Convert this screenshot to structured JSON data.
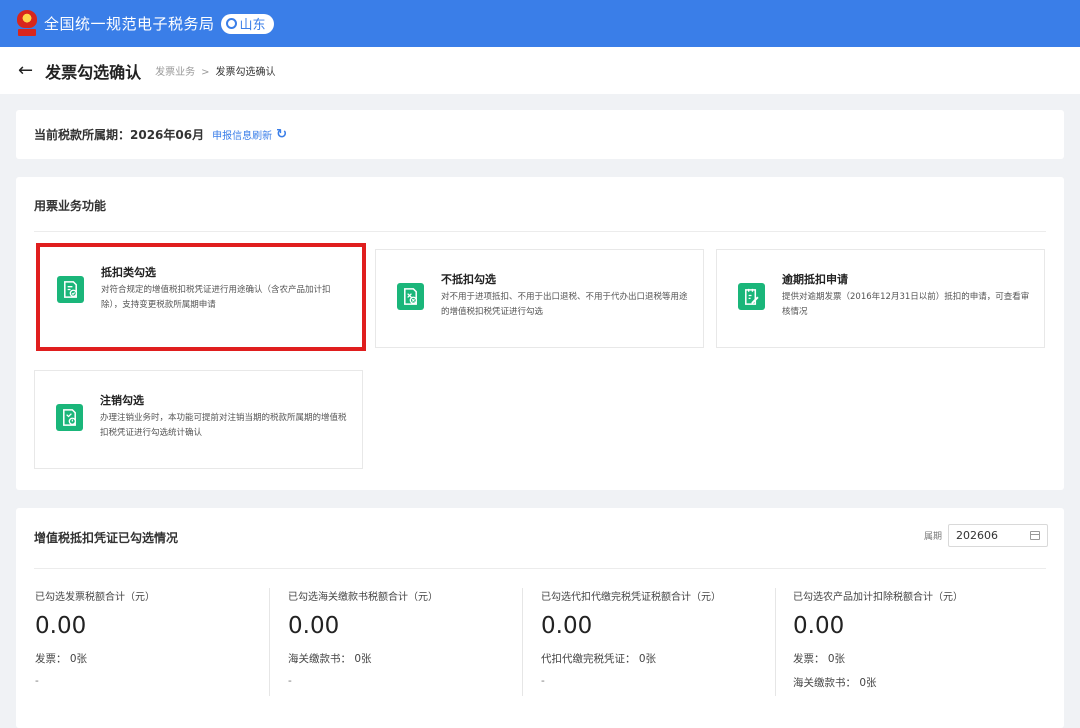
{
  "header": {
    "app_title": "全国统一规范电子税务局",
    "region": "山东"
  },
  "nav": {
    "back_icon": "←",
    "page_title": "发票勾选确认",
    "breadcrumb": [
      "发票业务",
      "发票勾选确认"
    ],
    "breadcrumb_sep": ">"
  },
  "period_bar": {
    "label": "当前税款所属期：2026年06月",
    "refresh_label": "申报信息刷新",
    "refresh_icon": "↻"
  },
  "functions": {
    "title": "用票业务功能",
    "tiles": [
      {
        "title": "抵扣类勾选",
        "desc": "对符合规定的增值税扣税凭证进行用途确认（含农产品加计扣除），支持变更税款所属期申请",
        "icon": "check-doc-icon",
        "selected": true
      },
      {
        "title": "不抵扣勾选",
        "desc": "对不用于进项抵扣、不用于出口退税、不用于代办出口退税等用途的增值税扣税凭证进行勾选",
        "icon": "cancel-doc-icon",
        "selected": false
      },
      {
        "title": "逾期抵扣申请",
        "desc": "提供对逾期发票（2016年12月31日以前）抵扣的申请，可查看审核情况",
        "icon": "edit-doc-icon",
        "selected": false
      },
      {
        "title": "注销勾选",
        "desc": "办理注销业务时，本功能可提前对注销当期的税款所属期的增值税扣税凭证进行勾选统计确认",
        "icon": "power-doc-icon",
        "selected": false
      }
    ]
  },
  "summary": {
    "title": "增值税抵扣凭证已勾选情况",
    "period_label": "属期",
    "period_value": "202606",
    "columns": [
      {
        "label": "已勾选发票税额合计（元）",
        "amount": "0.00",
        "line1": "发票：  0张",
        "line2": "-"
      },
      {
        "label": "已勾选海关缴款书税额合计（元）",
        "amount": "0.00",
        "line1": "海关缴款书：  0张",
        "line2": "-"
      },
      {
        "label": "已勾选代扣代缴完税凭证税额合计（元）",
        "amount": "0.00",
        "line1": "代扣代缴完税凭证：  0张",
        "line2": "-"
      },
      {
        "label": "已勾选农产品加计扣除税额合计（元）",
        "amount": "0.00",
        "line1": "发票：  0张",
        "line2": "海关缴款书：  0张"
      }
    ]
  },
  "colors": {
    "brand_blue": "#3a7ee8",
    "icon_green": "#1ab67a",
    "highlight_red": "#e01e1e"
  }
}
